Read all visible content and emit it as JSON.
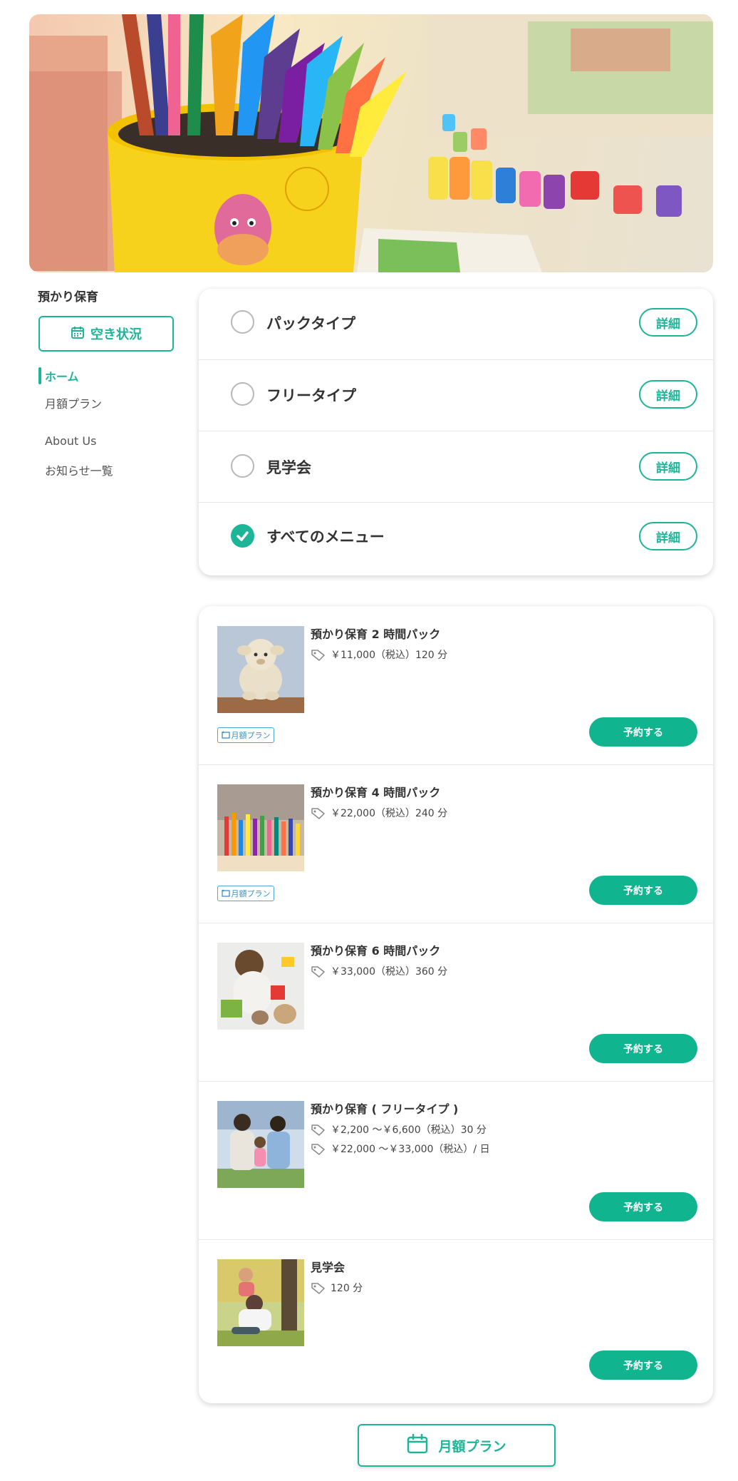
{
  "sidebar": {
    "title": "預かり保育",
    "vacancy_button": "空き状況",
    "nav": [
      {
        "label": "ホーム",
        "active": true
      },
      {
        "label": "月額プラン",
        "active": false
      },
      {
        "label": "About Us",
        "active": false
      },
      {
        "label": "お知らせ一覧",
        "active": false
      }
    ]
  },
  "filters": [
    {
      "label": "パックタイプ",
      "checked": false,
      "detail": "詳細"
    },
    {
      "label": "フリータイプ",
      "checked": false,
      "detail": "詳細"
    },
    {
      "label": "見学会",
      "checked": false,
      "detail": "詳細"
    },
    {
      "label": "すべてのメニュー",
      "checked": true,
      "detail": "詳細"
    }
  ],
  "menu_items": [
    {
      "title": "預かり保育 2 時間パック",
      "prices": [
        "￥11,000（税込）120 分"
      ],
      "badge": "月額プラン",
      "reserve": "予約する",
      "thumb": "teddy-bear"
    },
    {
      "title": "預かり保育 4 時間パック",
      "prices": [
        "￥22,000（税込）240 分"
      ],
      "badge": "月額プラン",
      "reserve": "予約する",
      "thumb": "colored-pencils"
    },
    {
      "title": "預かり保育 6 時間パック",
      "prices": [
        "￥33,000（税込）360 分"
      ],
      "badge": "",
      "reserve": "予約する",
      "thumb": "child-playing"
    },
    {
      "title": "預かり保育 ( フリータイプ )",
      "prices": [
        "￥2,200 〜￥6,600（税込）30 分",
        "￥22,000 〜￥33,000（税込）/ 日"
      ],
      "badge": "",
      "reserve": "予約する",
      "thumb": "family-outdoors"
    },
    {
      "title": "見学会",
      "prices": [
        "120 分"
      ],
      "badge": "",
      "reserve": "予約する",
      "thumb": "parent-and-child"
    }
  ],
  "bottom_button": "月額プラン",
  "colors": {
    "accent": "#1db598",
    "reserve": "#10b48f",
    "badge": "#3b8fc6"
  }
}
